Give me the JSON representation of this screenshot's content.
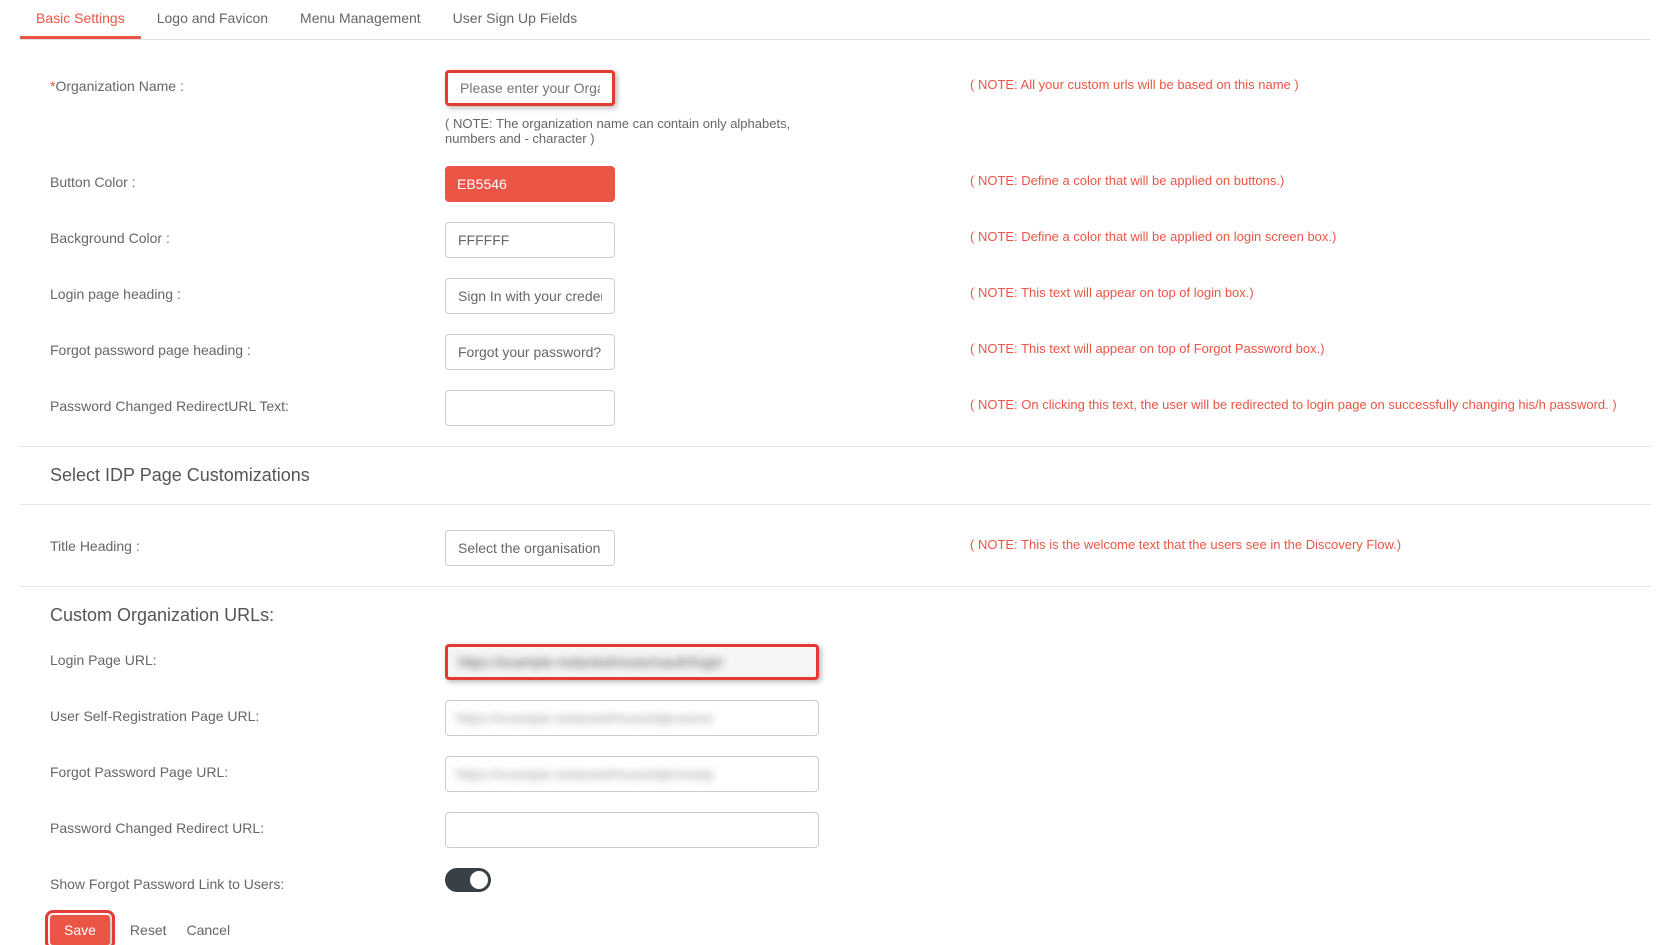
{
  "tabs": {
    "basic": "Basic Settings",
    "logo": "Logo and Favicon",
    "menu": "Menu Management",
    "signup": "User Sign Up Fields"
  },
  "org": {
    "label": "Organization Name :",
    "placeholder": "Please enter your Organi",
    "note_right": "( NOTE: All your custom urls will be based on this name )",
    "note_below": "( NOTE: The organization name can contain only alphabets, numbers and - character )"
  },
  "button_color": {
    "label": "Button Color :",
    "value": "EB5546",
    "note": "( NOTE: Define a color that will be applied on buttons.)"
  },
  "bg_color": {
    "label": "Background Color :",
    "value": "FFFFFF",
    "note": "( NOTE: Define a color that will be applied on login screen box.)"
  },
  "login_heading": {
    "label": "Login page heading :",
    "value": "Sign In with your credent",
    "note": "( NOTE: This text will appear on top of login box.)"
  },
  "forgot_heading": {
    "label": "Forgot password page heading :",
    "value": "Forgot your password?",
    "note": "( NOTE: This text will appear on top of Forgot Password box.)"
  },
  "pwd_redirect": {
    "label": "Password Changed RedirectURL Text:",
    "value": "",
    "note": "( NOTE: On clicking this text, the user will be redirected to login page on successfully changing his/h password. )"
  },
  "idp_section": "Select IDP Page Customizations",
  "title_heading": {
    "label": "Title Heading :",
    "value": "Select the organisation y",
    "note": "( NOTE: This is the welcome text that the users see in the Discovery Flow.)"
  },
  "urls_section": "Custom Organization URLs:",
  "login_url": {
    "label": "Login Page URL:",
    "value": "https://example-redacted/moas/oauth/login"
  },
  "self_reg_url": {
    "label": "User Self-Registration Page URL:",
    "value": "https://example-redacted/moas/idp/usersr"
  },
  "forgot_url": {
    "label": "Forgot Password Page URL:",
    "value": "https://example-redacted/moas/idp/resetp"
  },
  "pwd_changed_url": {
    "label": "Password Changed Redirect URL:",
    "value": ""
  },
  "show_forgot": {
    "label": "Show Forgot Password Link to Users:"
  },
  "actions": {
    "save": "Save",
    "reset": "Reset",
    "cancel": "Cancel"
  }
}
